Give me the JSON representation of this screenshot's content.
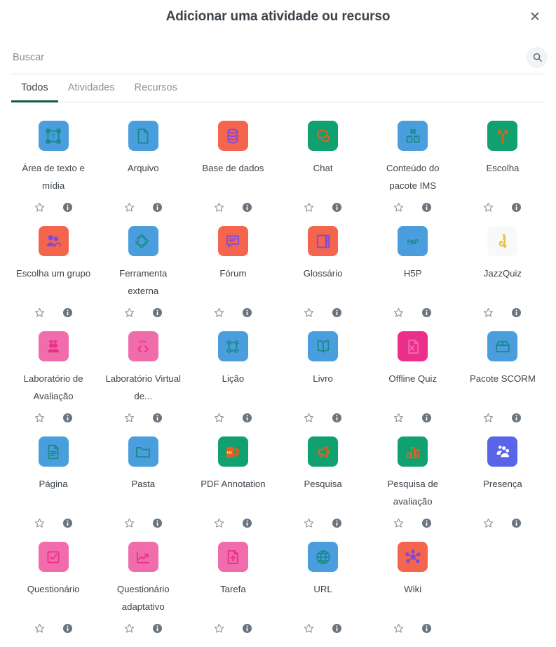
{
  "modal": {
    "title": "Adicionar uma atividade ou recurso",
    "close_label": "✕"
  },
  "search": {
    "placeholder": "Buscar",
    "value": "",
    "icon": "search-icon"
  },
  "tabs": [
    {
      "label": "Todos",
      "active": true
    },
    {
      "label": "Atividades",
      "active": false
    },
    {
      "label": "Recursos",
      "active": false
    }
  ],
  "actions": {
    "star_icon": "star-outline-icon",
    "info_icon": "info-circle-icon",
    "star_title": "Favoritar",
    "info_title": "Informações"
  },
  "colors": {
    "tile_blue": "#4a9ede",
    "tile_red": "#f4654e",
    "tile_green": "#11a06f",
    "tile_pink": "#f06cab",
    "tile_magenta": "#ed2f8c",
    "tile_purple": "#5865e8",
    "tile_white": "#f8f9fa",
    "glyph_teal": "#1a8a8a",
    "glyph_purple": "#7d4ae0",
    "glyph_orange": "#e8601c",
    "glyph_magenta": "#ed2f8c",
    "glyph_pink": "#f06cab",
    "glyph_white": "#ffffff",
    "glyph_yellow": "#e8c33a",
    "accent_tab": "#0f5c3e",
    "text": "#3d444b",
    "muted": "#8d949b"
  },
  "items": [
    {
      "label": "Área de texto e mídia",
      "icon": "text-media-area-icon",
      "tile": "blue",
      "glyph": "teal"
    },
    {
      "label": "Arquivo",
      "icon": "file-icon",
      "tile": "blue",
      "glyph": "teal"
    },
    {
      "label": "Base de dados",
      "icon": "database-icon",
      "tile": "red",
      "glyph": "purple"
    },
    {
      "label": "Chat",
      "icon": "chat-bubbles-icon",
      "tile": "green",
      "glyph": "orange"
    },
    {
      "label": "Conteúdo do pacote IMS",
      "icon": "ims-package-icon",
      "tile": "blue",
      "glyph": "teal"
    },
    {
      "label": "Escolha",
      "icon": "choice-fork-icon",
      "tile": "green",
      "glyph": "orange"
    },
    {
      "label": "Escolha um grupo",
      "icon": "group-choice-icon",
      "tile": "red",
      "glyph": "purple"
    },
    {
      "label": "Ferramenta externa",
      "icon": "puzzle-piece-icon",
      "tile": "blue",
      "glyph": "teal"
    },
    {
      "label": "Fórum",
      "icon": "forum-icon",
      "tile": "red",
      "glyph": "purple"
    },
    {
      "label": "Glossário",
      "icon": "glossary-book-icon",
      "tile": "red",
      "glyph": "purple"
    },
    {
      "label": "H5P",
      "icon": "h5p-icon",
      "tile": "blue",
      "glyph": "teal"
    },
    {
      "label": "JazzQuiz",
      "icon": "saxophone-icon",
      "tile": "white",
      "glyph": "yellow"
    },
    {
      "label": "Laboratório de Avaliação",
      "icon": "workshop-icon",
      "tile": "pink",
      "glyph": "magenta"
    },
    {
      "label": "Laboratório Virtual de...",
      "icon": "vpl-code-icon",
      "tile": "pink",
      "glyph": "magenta"
    },
    {
      "label": "Lição",
      "icon": "lesson-path-icon",
      "tile": "blue",
      "glyph": "teal"
    },
    {
      "label": "Livro",
      "icon": "book-icon",
      "tile": "blue",
      "glyph": "teal"
    },
    {
      "label": "Offline Quiz",
      "icon": "offline-quiz-icon",
      "tile": "magenta",
      "glyph": "pink"
    },
    {
      "label": "Pacote SCORM",
      "icon": "scorm-box-icon",
      "tile": "blue",
      "glyph": "teal"
    },
    {
      "label": "Página",
      "icon": "page-icon",
      "tile": "blue",
      "glyph": "teal"
    },
    {
      "label": "Pasta",
      "icon": "folder-icon",
      "tile": "blue",
      "glyph": "teal"
    },
    {
      "label": "PDF Annotation",
      "icon": "pdf-annotation-icon",
      "tile": "green",
      "glyph": "orange"
    },
    {
      "label": "Pesquisa",
      "icon": "megaphone-icon",
      "tile": "green",
      "glyph": "orange"
    },
    {
      "label": "Pesquisa de avaliação",
      "icon": "survey-bars-icon",
      "tile": "green",
      "glyph": "orange"
    },
    {
      "label": "Presença",
      "icon": "attendance-icon",
      "tile": "purple",
      "glyph": "white"
    },
    {
      "label": "Questionário",
      "icon": "quiz-checkbox-icon",
      "tile": "pink",
      "glyph": "magenta"
    },
    {
      "label": "Questionário adaptativo",
      "icon": "adaptive-quiz-chart-icon",
      "tile": "pink",
      "glyph": "magenta"
    },
    {
      "label": "Tarefa",
      "icon": "assignment-upload-icon",
      "tile": "pink",
      "glyph": "magenta"
    },
    {
      "label": "URL",
      "icon": "globe-icon",
      "tile": "blue",
      "glyph": "teal"
    },
    {
      "label": "Wiki",
      "icon": "wiki-network-icon",
      "tile": "red",
      "glyph": "purple"
    }
  ]
}
